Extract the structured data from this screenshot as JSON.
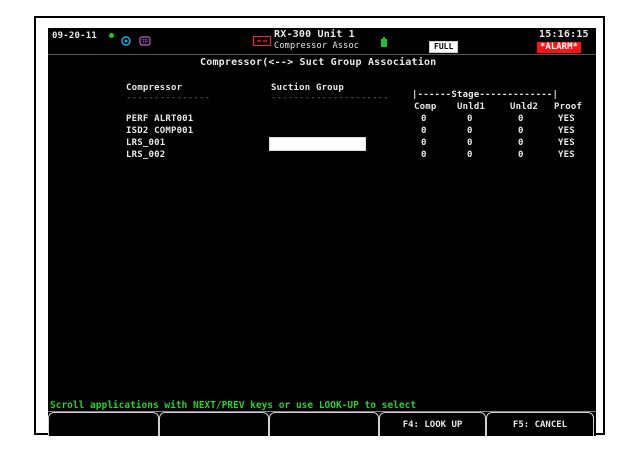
{
  "header": {
    "date": "09-20-11",
    "unit_name": "RX-300 Unit 1",
    "screen_name": "Compressor Assoc",
    "full_label": "FULL",
    "time": "15:16:15",
    "alarm_label": "*ALARM*"
  },
  "title": "Compressor(<--> Suct Group Association",
  "columns": {
    "compressor": "Compressor",
    "suction_group": "Suction Group",
    "compressor_rule": "---------------",
    "suction_rule": "---------------------",
    "stage_header": "|------Stage-------------|",
    "sub_headers": [
      "Comp",
      "Unld1",
      "Unld2",
      "Proof"
    ]
  },
  "rows": [
    {
      "compressor": "PERF ALRT001",
      "suction_group": "",
      "comp": "0",
      "unld1": "0",
      "unld2": "0",
      "proof": "YES"
    },
    {
      "compressor": "ISD2 COMP001",
      "suction_group": "",
      "comp": "0",
      "unld1": "0",
      "unld2": "0",
      "proof": "YES"
    },
    {
      "compressor": "LRS_001",
      "suction_group": "",
      "comp": "0",
      "unld1": "0",
      "unld2": "0",
      "proof": "YES"
    },
    {
      "compressor": "LRS_002",
      "suction_group": "",
      "comp": "0",
      "unld1": "0",
      "unld2": "0",
      "proof": "YES"
    }
  ],
  "footer": {
    "message": "Scroll applications with NEXT/PREV keys or use LOOK-UP to select",
    "fkeys": [
      "",
      "",
      "",
      "F4: LOOK UP",
      "F5: CANCEL"
    ]
  },
  "colors": {
    "status_green": "#22c32d",
    "alarm_red": "#ff1111",
    "message_green": "#2cd12e"
  },
  "icons": [
    "status-dot-icon",
    "network-icon",
    "device-icon",
    "controller-icon",
    "battery-icon"
  ]
}
